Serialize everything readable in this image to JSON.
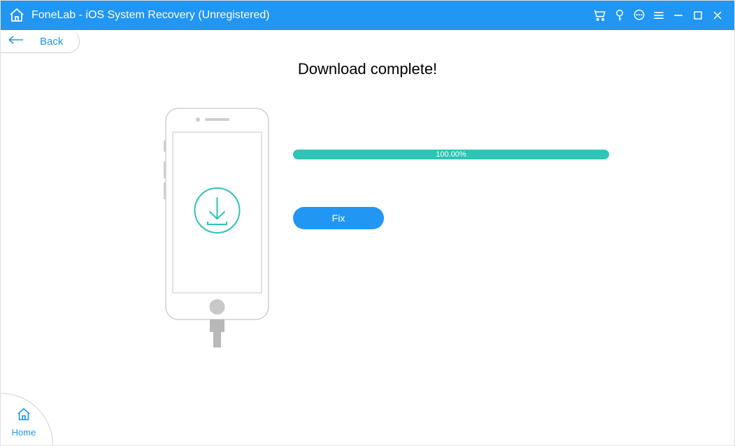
{
  "titlebar": {
    "title": "FoneLab - iOS System Recovery (Unregistered)"
  },
  "back": {
    "label": "Back"
  },
  "main": {
    "headline": "Download complete!",
    "progress_text": "100.00%",
    "fix_label": "Fix"
  },
  "home_btn": {
    "label": "Home"
  },
  "colors": {
    "accent": "#2196F3",
    "progress": "#2EC4B6"
  }
}
